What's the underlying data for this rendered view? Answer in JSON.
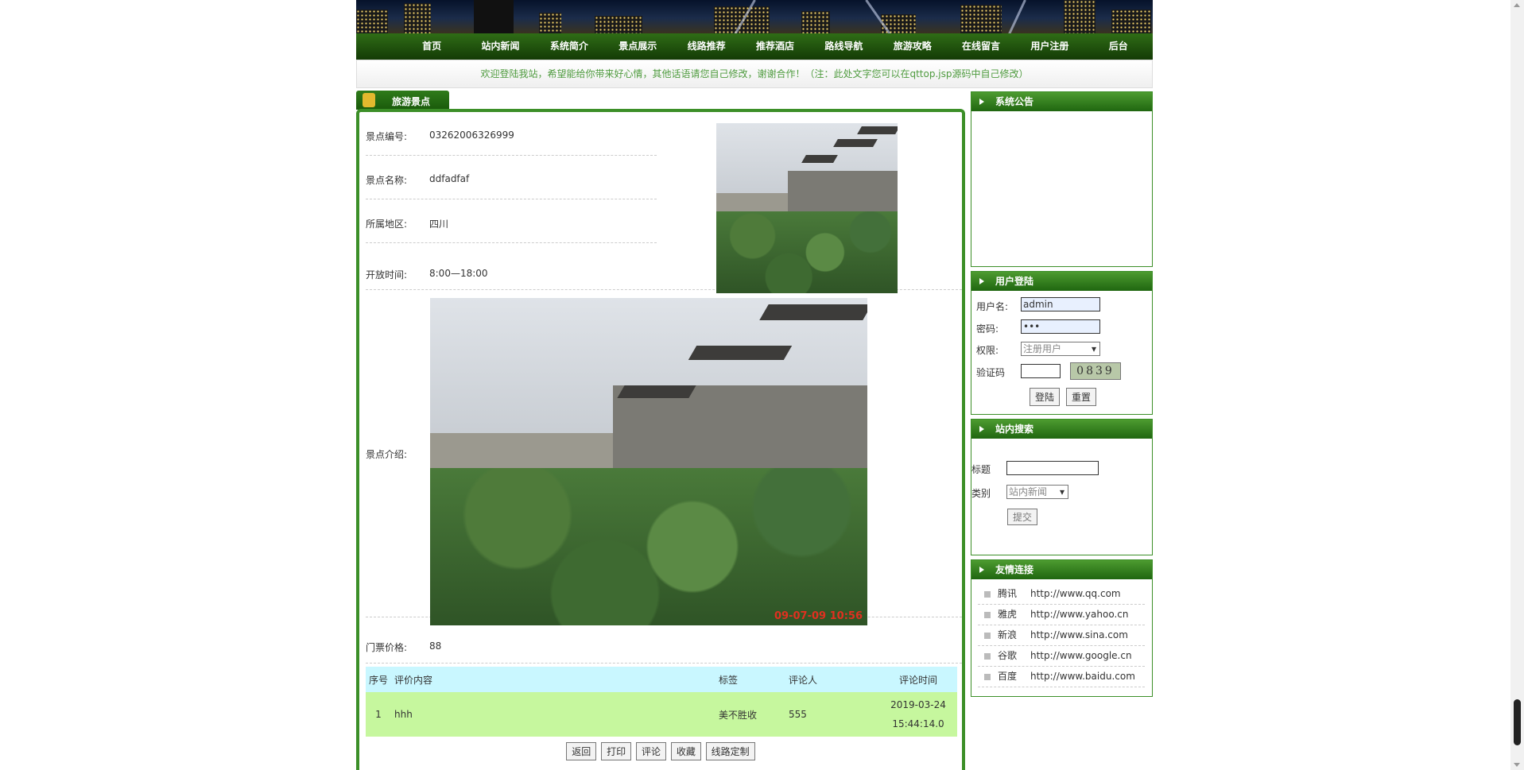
{
  "nav": [
    "首页",
    "站内新闻",
    "系统简介",
    "景点展示",
    "线路推荐",
    "推荐酒店",
    "路线导航",
    "旅游攻略",
    "在线留言",
    "用户注册",
    "后台"
  ],
  "notice": "欢迎登陆我站，希望能给你带来好心情，其他话语请您自己修改，谢谢合作！（注：此处文字您可以在qttop.jsp源码中自己修改）",
  "tab_label": "旅游景点",
  "spot": {
    "id_label": "景点编号:",
    "id_value": "03262006326999",
    "name_label": "景点名称:",
    "name_value": "ddfadfaf",
    "region_label": "所属地区:",
    "region_value": "四川",
    "hours_label": "开放时间:",
    "hours_value": "8:00—18:00",
    "intro_label": "景点介绍:",
    "price_label": "门票价格:",
    "price_value": "88",
    "photo_stamp": "09-07-09 10:56"
  },
  "comments": {
    "headers": [
      "序号",
      "评价内容",
      "标签",
      "评论人",
      "评论时间"
    ],
    "rows": [
      {
        "no": "1",
        "content": "hhh",
        "tag": "美不胜收",
        "user": "555",
        "date": "2019-03-24",
        "time": "15:44:14.0"
      }
    ]
  },
  "buttons": [
    "返回",
    "打印",
    "评论",
    "收藏",
    "线路定制"
  ],
  "sidebar": {
    "announce_title": "系统公告",
    "login": {
      "title": "用户登陆",
      "user_label": "用户名:",
      "user_value": "admin",
      "pwd_label": "密码:",
      "pwd_value": "•••",
      "role_label": "权限:",
      "role_value": "注册用户",
      "captcha_label": "验证码",
      "captcha_code": "0839",
      "login_btn": "登陆",
      "reset_btn": "重置"
    },
    "search": {
      "title": "站内搜索",
      "title_label": "标题",
      "type_label": "类别",
      "type_value": "站内新闻",
      "submit": "提交"
    },
    "links": {
      "title": "友情连接",
      "items": [
        {
          "name": "腾讯",
          "url": "http://www.qq.com"
        },
        {
          "name": "雅虎",
          "url": "http://www.yahoo.cn"
        },
        {
          "name": "新浪",
          "url": "http://www.sina.com"
        },
        {
          "name": "谷歌",
          "url": "http://www.google.cn"
        },
        {
          "name": "百度",
          "url": "http://www.baidu.com"
        }
      ]
    }
  },
  "colors": {
    "nav_green": "#1f4f0c",
    "panel_green": "#3c8f28",
    "notice_text": "#4f9b3f",
    "table_header": "#c9f7ff",
    "table_row": "#c6f79e"
  }
}
